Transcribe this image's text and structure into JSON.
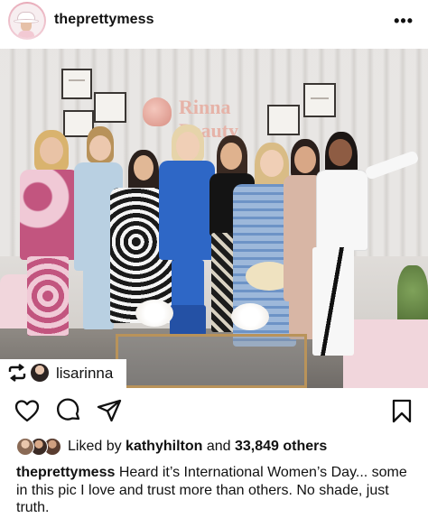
{
  "post": {
    "username": "theprettymess",
    "more_label": "•••"
  },
  "photo": {
    "brand_line1": "Rinna",
    "brand_line2": "Beauty"
  },
  "repost": {
    "icon": "repost-icon",
    "username": "lisarinna"
  },
  "actions": {
    "like": "heart-icon",
    "comment": "comment-icon",
    "share": "share-icon",
    "save": "bookmark-icon"
  },
  "likes": {
    "prefix": "Liked by ",
    "user": "kathyhilton",
    "middle": " and ",
    "count": "33,849 others"
  },
  "caption": {
    "username": "theprettymess",
    "text": " Heard it’s International Women’s Day... some in this pic I love and trust more than others. No shade, just truth."
  }
}
